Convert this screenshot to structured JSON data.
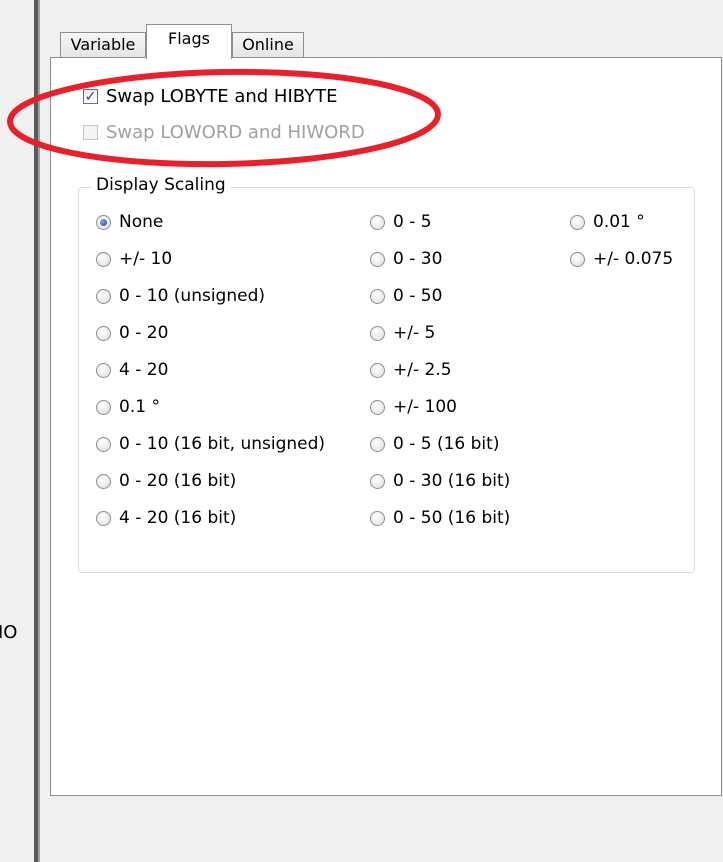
{
  "left_panel": {
    "clipped_text": "IO"
  },
  "tabs": [
    {
      "label": "Variable",
      "selected": false
    },
    {
      "label": "Flags",
      "selected": true
    },
    {
      "label": "Online",
      "selected": false
    }
  ],
  "flags": {
    "swap_bytes": {
      "label": "Swap LOBYTE and HIBYTE",
      "checked": true,
      "enabled": true
    },
    "swap_words": {
      "label": "Swap LOWORD and HIWORD",
      "checked": false,
      "enabled": false
    }
  },
  "highlight": {
    "color": "#e8202a",
    "shape": "ellipse"
  },
  "display_scaling": {
    "title": "Display Scaling",
    "selected": "None",
    "col1": [
      "None",
      "+/- 10",
      "0 - 10 (unsigned)",
      "0 - 20",
      "4 - 20",
      "0.1 °",
      "0 - 10 (16 bit, unsigned)",
      "0 - 20 (16 bit)",
      "4 - 20 (16 bit)"
    ],
    "col2": [
      "0 - 5",
      "0 - 30",
      "0 - 50",
      "+/- 5",
      "+/- 2.5",
      "+/- 100",
      "0 - 5 (16 bit)",
      "0 - 30 (16 bit)",
      "0 - 50 (16 bit)"
    ],
    "col3": [
      "0.01 °",
      "+/- 0.075"
    ]
  }
}
